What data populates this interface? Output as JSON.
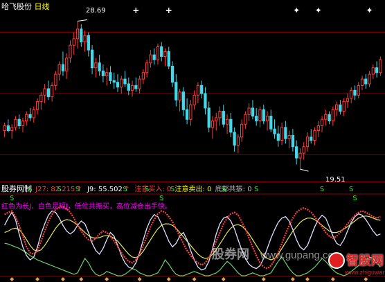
{
  "colors": {
    "up": "#ff3c3c",
    "down": "#44d8e8",
    "grid": "#8b0000",
    "white": "#ffffff",
    "yellow": "#ffff00",
    "magenta": "#ff00ff",
    "green": "#00ff00",
    "signal_s": "#22ee22",
    "k_line": "#ff4040",
    "j_line": "#e0e0ff",
    "yellow_line": "#e6e65a",
    "green_line": "#6cd06c"
  },
  "main": {
    "title_stock": "哈飞股份",
    "title_period": "日线",
    "high_label": "28.69",
    "low_label": "19.51",
    "star_glyph": "✦",
    "cross_glyph": "+"
  },
  "indicator": {
    "name": "股券网制",
    "j27_label": "J27: 82.215",
    "j27_arrow": "↑",
    "j9_label": "J9: 55.502",
    "j9_arrow": "↑",
    "buy_label": "注意买入: 0",
    "sell_label": "注意卖出: 0",
    "bottom_label": "底部共振: 0",
    "subtitle": "红色为长J、白色是短J，低位共振买，高位减仓出手快。",
    "signal_glyph": "S"
  },
  "watermark": {
    "site_cn": "股券网",
    "site_url": "www.gupang.com",
    "logo_cn": "智股网",
    "logo_url": "www.zhiguwang.cn"
  },
  "chart_data": [
    {
      "type": "candlestick",
      "title": "哈飞股份 日线",
      "ohlc": [
        [
          21.9,
          22.4,
          21.5,
          22.2
        ],
        [
          22.2,
          22.6,
          21.8,
          21.9
        ],
        [
          21.9,
          22.3,
          21.4,
          22.1
        ],
        [
          22.1,
          22.8,
          21.9,
          22.6
        ],
        [
          22.6,
          22.9,
          22.0,
          22.2
        ],
        [
          22.2,
          22.7,
          21.8,
          22.5
        ],
        [
          22.5,
          23.1,
          22.2,
          22.9
        ],
        [
          22.9,
          23.3,
          22.5,
          22.7
        ],
        [
          22.7,
          23.4,
          22.4,
          23.2
        ],
        [
          23.2,
          23.9,
          22.9,
          23.7
        ],
        [
          23.7,
          24.3,
          23.2,
          24.1
        ],
        [
          24.1,
          24.8,
          23.6,
          24.5
        ],
        [
          24.5,
          25.0,
          23.8,
          24.0
        ],
        [
          24.0,
          24.9,
          23.7,
          24.7
        ],
        [
          24.7,
          25.6,
          24.4,
          25.4
        ],
        [
          25.4,
          26.2,
          25.0,
          26.0
        ],
        [
          26.0,
          26.8,
          25.3,
          25.6
        ],
        [
          25.6,
          26.7,
          25.1,
          26.4
        ],
        [
          26.4,
          27.5,
          26.1,
          27.2
        ],
        [
          27.2,
          28.0,
          26.6,
          27.6
        ],
        [
          27.6,
          28.69,
          27.0,
          28.2
        ],
        [
          28.2,
          28.5,
          27.1,
          27.4
        ],
        [
          27.4,
          28.1,
          26.8,
          27.8
        ],
        [
          27.8,
          28.0,
          26.5,
          26.9
        ],
        [
          26.9,
          27.2,
          25.4,
          25.8
        ],
        [
          25.8,
          26.4,
          25.2,
          26.1
        ],
        [
          26.1,
          26.6,
          25.3,
          25.6
        ],
        [
          25.6,
          26.0,
          24.9,
          25.3
        ],
        [
          25.3,
          25.8,
          24.7,
          25.5
        ],
        [
          25.5,
          25.9,
          24.8,
          25.0
        ],
        [
          25.0,
          25.5,
          24.5,
          24.9
        ],
        [
          24.9,
          25.4,
          24.3,
          24.6
        ],
        [
          24.6,
          25.3,
          24.2,
          25.1
        ],
        [
          25.1,
          25.6,
          24.6,
          24.8
        ],
        [
          24.8,
          25.2,
          24.1,
          24.4
        ],
        [
          24.4,
          25.0,
          24.0,
          24.7
        ],
        [
          24.7,
          25.2,
          24.3,
          24.5
        ],
        [
          24.5,
          25.3,
          24.2,
          25.1
        ],
        [
          25.1,
          25.7,
          24.8,
          25.5
        ],
        [
          25.5,
          26.3,
          25.2,
          26.1
        ],
        [
          26.1,
          26.9,
          25.8,
          26.6
        ],
        [
          26.6,
          27.0,
          26.0,
          26.3
        ],
        [
          26.3,
          27.3,
          26.0,
          27.1
        ],
        [
          27.1,
          27.4,
          26.2,
          26.5
        ],
        [
          26.5,
          27.0,
          25.9,
          26.8
        ],
        [
          26.8,
          27.1,
          25.7,
          25.9
        ],
        [
          25.9,
          26.2,
          24.6,
          24.9
        ],
        [
          24.9,
          25.4,
          23.4,
          23.8
        ],
        [
          23.8,
          24.5,
          23.1,
          24.3
        ],
        [
          24.3,
          24.6,
          22.8,
          23.2
        ],
        [
          23.2,
          23.9,
          22.3,
          22.6
        ],
        [
          22.6,
          23.8,
          22.2,
          23.5
        ],
        [
          23.5,
          24.4,
          23.2,
          24.1
        ],
        [
          24.1,
          24.9,
          23.6,
          24.7
        ],
        [
          24.7,
          25.0,
          23.9,
          24.2
        ],
        [
          24.2,
          24.6,
          22.9,
          23.3
        ],
        [
          23.3,
          23.7,
          21.8,
          22.1
        ],
        [
          22.1,
          22.8,
          21.4,
          22.5
        ],
        [
          22.5,
          23.0,
          21.9,
          22.7
        ],
        [
          22.7,
          23.4,
          22.2,
          23.1
        ],
        [
          23.1,
          23.5,
          22.1,
          22.3
        ],
        [
          22.3,
          22.9,
          21.7,
          22.6
        ],
        [
          22.6,
          23.0,
          21.5,
          21.8
        ],
        [
          21.8,
          22.1,
          20.6,
          21.0
        ],
        [
          21.0,
          21.7,
          20.5,
          21.5
        ],
        [
          21.5,
          22.6,
          21.2,
          22.3
        ],
        [
          22.3,
          23.1,
          22.0,
          22.9
        ],
        [
          22.9,
          23.6,
          22.5,
          23.3
        ],
        [
          23.3,
          23.8,
          22.6,
          22.8
        ],
        [
          22.8,
          23.3,
          22.2,
          22.5
        ],
        [
          22.5,
          23.4,
          22.1,
          23.2
        ],
        [
          23.2,
          23.5,
          22.3,
          22.5
        ],
        [
          22.5,
          23.1,
          21.9,
          22.8
        ],
        [
          22.8,
          23.2,
          21.8,
          22.0
        ],
        [
          22.0,
          22.6,
          21.4,
          21.7
        ],
        [
          21.7,
          22.2,
          20.9,
          21.3
        ],
        [
          21.3,
          22.4,
          21.0,
          22.1
        ],
        [
          22.1,
          22.5,
          21.1,
          21.4
        ],
        [
          21.4,
          21.9,
          20.8,
          21.6
        ],
        [
          21.6,
          22.0,
          20.6,
          20.9
        ],
        [
          20.9,
          21.3,
          19.8,
          20.2
        ],
        [
          20.2,
          20.8,
          19.51,
          20.5
        ],
        [
          20.5,
          21.2,
          20.1,
          20.9
        ],
        [
          20.9,
          21.8,
          20.6,
          21.5
        ],
        [
          21.5,
          22.0,
          21.1,
          21.3
        ],
        [
          21.3,
          22.1,
          21.0,
          21.9
        ],
        [
          21.9,
          22.5,
          21.5,
          22.2
        ],
        [
          22.2,
          22.8,
          21.8,
          22.6
        ],
        [
          22.6,
          23.2,
          22.2,
          22.9
        ],
        [
          22.9,
          23.1,
          22.3,
          22.5
        ],
        [
          22.5,
          23.4,
          22.2,
          23.2
        ],
        [
          23.2,
          23.7,
          22.8,
          23.5
        ],
        [
          23.5,
          23.8,
          22.9,
          23.1
        ],
        [
          23.1,
          23.9,
          22.8,
          23.7
        ],
        [
          23.7,
          24.2,
          23.3,
          23.9
        ],
        [
          23.9,
          24.6,
          23.6,
          24.4
        ],
        [
          24.4,
          24.7,
          23.8,
          24.1
        ],
        [
          24.1,
          24.9,
          23.9,
          24.7
        ],
        [
          24.7,
          25.3,
          24.4,
          25.1
        ],
        [
          25.1,
          25.4,
          24.5,
          24.8
        ],
        [
          24.8,
          25.6,
          24.6,
          25.4
        ],
        [
          25.4,
          26.0,
          25.1,
          25.8
        ],
        [
          25.8,
          26.2,
          25.2,
          25.5
        ],
        [
          25.5,
          26.5,
          25.3,
          26.3
        ]
      ],
      "y_range": [
        19.0,
        29.4
      ],
      "high_marker": {
        "value": 28.69,
        "index": 20
      },
      "low_marker": {
        "value": 19.51,
        "index": 81
      },
      "top_markers": [
        {
          "index": 36,
          "glyph": "+"
        },
        {
          "index": 45,
          "glyph": "+"
        },
        {
          "index": 80,
          "glyph": "✦"
        },
        {
          "index": 86,
          "glyph": "✦"
        },
        {
          "index": 100,
          "glyph": "✦"
        }
      ],
      "grid_prices": [
        28.0,
        24.2,
        20.4
      ]
    },
    {
      "type": "line",
      "title": "股券网制",
      "y_range": [
        0,
        100
      ],
      "series": [
        {
          "name": "J27",
          "color_key": "k_line",
          "values": [
            85,
            88,
            90,
            82,
            70,
            55,
            40,
            32,
            30,
            35,
            48,
            62,
            75,
            85,
            92,
            95,
            96,
            93,
            88,
            80,
            70,
            62,
            55,
            50,
            48,
            52,
            58,
            62,
            60,
            55,
            48,
            40,
            32,
            25,
            20,
            18,
            22,
            30,
            42,
            55,
            68,
            78,
            86,
            90,
            88,
            82,
            75,
            65,
            55,
            45,
            35,
            28,
            22,
            18,
            15,
            18,
            25,
            35,
            48,
            60,
            72,
            80,
            86,
            88,
            84,
            75,
            65,
            52,
            40,
            28,
            18,
            12,
            10,
            14,
            22,
            32,
            45,
            58,
            70,
            80,
            88,
            92,
            94,
            92,
            88,
            82,
            75,
            68,
            60,
            55,
            52,
            55,
            60,
            66,
            72,
            78,
            84,
            88,
            90,
            88,
            85,
            82,
            80,
            82
          ]
        },
        {
          "name": "J9",
          "color_key": "j_line",
          "values": [
            70,
            80,
            88,
            78,
            58,
            40,
            28,
            22,
            26,
            40,
            58,
            72,
            84,
            90,
            88,
            80,
            70,
            62,
            58,
            62,
            70,
            76,
            72,
            60,
            45,
            35,
            30,
            38,
            50,
            60,
            55,
            42,
            28,
            18,
            12,
            10,
            18,
            32,
            50,
            66,
            78,
            85,
            82,
            72,
            60,
            48,
            40,
            45,
            55,
            60,
            50,
            35,
            22,
            12,
            8,
            10,
            20,
            38,
            58,
            72,
            80,
            82,
            76,
            65,
            50,
            36,
            24,
            16,
            12,
            10,
            14,
            24,
            38,
            52,
            64,
            74,
            80,
            82,
            76,
            64,
            50,
            40,
            36,
            42,
            55,
            68,
            78,
            84,
            80,
            68,
            55,
            45,
            42,
            50,
            62,
            74,
            82,
            86,
            84,
            78,
            70,
            62,
            56,
            58
          ]
        },
        {
          "name": "yellow",
          "color_key": "yellow_line",
          "values": [
            60,
            62,
            65,
            66,
            64,
            58,
            50,
            42,
            36,
            34,
            36,
            42,
            50,
            58,
            66,
            72,
            76,
            78,
            77,
            74,
            70,
            65,
            60,
            56,
            53,
            52,
            53,
            55,
            56,
            55,
            52,
            48,
            42,
            36,
            30,
            26,
            25,
            28,
            34,
            42,
            50,
            58,
            65,
            70,
            72,
            72,
            70,
            66,
            60,
            54,
            48,
            42,
            36,
            30,
            26,
            24,
            25,
            30,
            36,
            44,
            52,
            60,
            66,
            70,
            71,
            69,
            64,
            58,
            50,
            42,
            34,
            28,
            24,
            22,
            24,
            30,
            38,
            46,
            54,
            62,
            68,
            74,
            78,
            80,
            80,
            78,
            74,
            70,
            66,
            62,
            60,
            60,
            62,
            65,
            68,
            72,
            76,
            80,
            82,
            83,
            82,
            80,
            78,
            77
          ]
        },
        {
          "name": "green",
          "color_key": "green_line",
          "values": [
            45,
            44,
            42,
            40,
            38,
            35,
            32,
            28,
            25,
            22,
            20,
            18,
            16,
            14,
            12,
            10,
            8,
            6,
            4,
            2,
            4,
            14,
            24,
            18,
            8,
            2,
            0,
            2,
            6,
            4,
            2,
            0,
            0,
            2,
            6,
            10,
            8,
            4,
            2,
            0,
            0,
            2,
            4,
            12,
            22,
            16,
            8,
            2,
            0,
            0,
            2,
            4,
            6,
            4,
            2,
            0,
            0,
            2,
            4,
            8,
            14,
            20,
            16,
            10,
            4,
            0,
            0,
            2,
            4,
            2,
            0,
            0,
            2,
            4,
            12,
            20,
            26,
            18,
            10,
            4,
            0,
            0,
            2,
            4,
            8,
            12,
            18,
            24,
            20,
            14,
            8,
            4,
            2,
            0,
            2,
            6,
            10,
            14,
            18,
            22,
            26,
            24,
            18,
            12
          ]
        }
      ],
      "signals": [
        {
          "index": 7,
          "label": "S",
          "row": "upper"
        },
        {
          "index": 15,
          "label": "S",
          "row": "upper"
        },
        {
          "index": 20,
          "label": "S",
          "row": "upper"
        },
        {
          "index": 33,
          "label": "S",
          "row": "upper"
        },
        {
          "index": 39,
          "label": "S",
          "row": "upper"
        },
        {
          "index": 46,
          "label": "S",
          "row": "upper"
        },
        {
          "index": 60,
          "label": "S",
          "row": "upper"
        },
        {
          "index": 69,
          "label": "S",
          "row": "upper"
        },
        {
          "index": 87,
          "label": "S",
          "row": "upper"
        },
        {
          "index": 95,
          "label": "S",
          "row": "upper"
        },
        {
          "index": 2,
          "label": "S",
          "row": "lower"
        },
        {
          "index": 43,
          "label": "S",
          "row": "lower"
        },
        {
          "index": 96,
          "label": "S",
          "row": "lower"
        }
      ],
      "diamonds_at": [
        2,
        9,
        16,
        21,
        28,
        37,
        45,
        52,
        60,
        71,
        79,
        83,
        90,
        99
      ]
    }
  ]
}
